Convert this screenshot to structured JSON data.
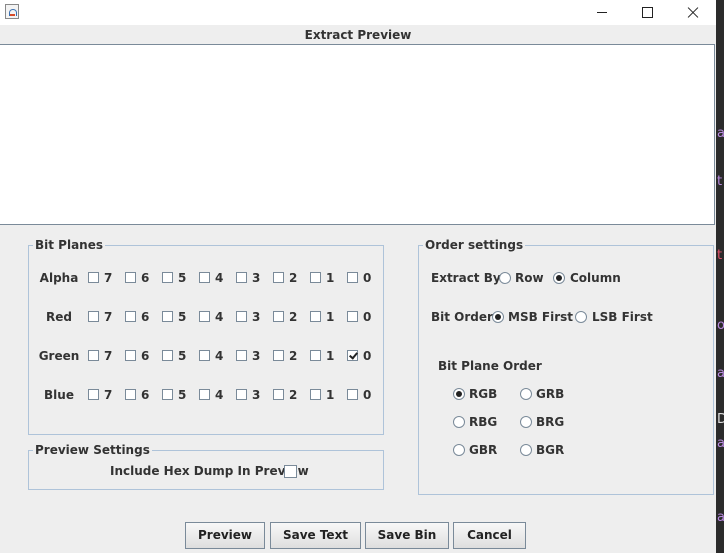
{
  "preview": {
    "title": "Extract Preview"
  },
  "bit_planes": {
    "legend": "Bit Planes",
    "rows": [
      {
        "label": "Alpha",
        "bits": [
          {
            "label": "7",
            "checked": false
          },
          {
            "label": "6",
            "checked": false
          },
          {
            "label": "5",
            "checked": false
          },
          {
            "label": "4",
            "checked": false
          },
          {
            "label": "3",
            "checked": false
          },
          {
            "label": "2",
            "checked": false
          },
          {
            "label": "1",
            "checked": false
          },
          {
            "label": "0",
            "checked": false
          }
        ]
      },
      {
        "label": "Red",
        "bits": [
          {
            "label": "7",
            "checked": false
          },
          {
            "label": "6",
            "checked": false
          },
          {
            "label": "5",
            "checked": false
          },
          {
            "label": "4",
            "checked": false
          },
          {
            "label": "3",
            "checked": false
          },
          {
            "label": "2",
            "checked": false
          },
          {
            "label": "1",
            "checked": false
          },
          {
            "label": "0",
            "checked": false
          }
        ]
      },
      {
        "label": "Green",
        "bits": [
          {
            "label": "7",
            "checked": false
          },
          {
            "label": "6",
            "checked": false
          },
          {
            "label": "5",
            "checked": false
          },
          {
            "label": "4",
            "checked": false
          },
          {
            "label": "3",
            "checked": false
          },
          {
            "label": "2",
            "checked": false
          },
          {
            "label": "1",
            "checked": false
          },
          {
            "label": "0",
            "checked": true
          }
        ]
      },
      {
        "label": "Blue",
        "bits": [
          {
            "label": "7",
            "checked": false
          },
          {
            "label": "6",
            "checked": false
          },
          {
            "label": "5",
            "checked": false
          },
          {
            "label": "4",
            "checked": false
          },
          {
            "label": "3",
            "checked": false
          },
          {
            "label": "2",
            "checked": false
          },
          {
            "label": "1",
            "checked": false
          },
          {
            "label": "0",
            "checked": false
          }
        ]
      }
    ]
  },
  "preview_settings": {
    "legend": "Preview Settings",
    "hex_dump_label": "Include Hex Dump In Preview",
    "hex_dump_checked": false
  },
  "order_settings": {
    "legend": "Order settings",
    "extract_by": {
      "label": "Extract By",
      "row_label": "Row",
      "column_label": "Column",
      "selected": "Column"
    },
    "bit_order": {
      "label": "Bit Order",
      "msb_label": "MSB First",
      "lsb_label": "LSB First",
      "selected": "MSB First"
    },
    "plane_order": {
      "label": "Bit Plane Order",
      "options": [
        "RGB",
        "GRB",
        "RBG",
        "BRG",
        "GBR",
        "BGR"
      ],
      "selected": "RGB"
    }
  },
  "buttons": {
    "preview": "Preview",
    "save_text": "Save Text",
    "save_bin": "Save Bin",
    "cancel": "Cancel"
  },
  "background_glimpse": [
    "a",
    "t",
    "t",
    "o",
    "a",
    "D",
    "a",
    "a"
  ],
  "colors": {
    "group_border": "#aec3d9",
    "panel": "#eeeeee",
    "text": "#333333"
  }
}
